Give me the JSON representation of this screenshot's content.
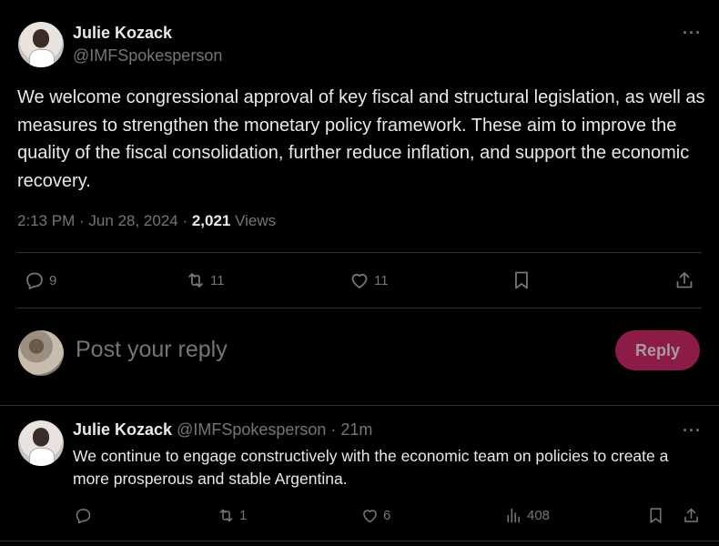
{
  "tweet": {
    "author_name": "Julie Kozack",
    "author_handle": "@IMFSpokesperson",
    "more_label": "···",
    "text": "We welcome congressional approval of key fiscal and structural legislation, as well as measures to strengthen the monetary policy framework. These aim to improve the quality of the fiscal consolidation, further reduce inflation, and support the economic recovery.",
    "time": "2:13 PM · Jun 28, 2024 · ",
    "views_count": "2,021",
    "views_label": " Views",
    "actions": {
      "replies": "9",
      "reposts": "11",
      "likes": "11"
    }
  },
  "composer": {
    "placeholder": "Post your reply",
    "reply_button": "Reply"
  },
  "reply": {
    "author_name": "Julie Kozack",
    "author_handle": "@IMFSpokesperson",
    "time": " · 21m",
    "more_label": "···",
    "text": "We continue to engage constructively with the economic team on policies to create a more prosperous and stable Argentina.",
    "actions": {
      "replies": "",
      "reposts": "1",
      "likes": "6",
      "views": "408"
    }
  },
  "colors": {
    "background": "#000000",
    "text": "#e7e9ea",
    "muted": "#71767b",
    "divider": "#2f3336",
    "reply_button": "#8b1b47"
  }
}
